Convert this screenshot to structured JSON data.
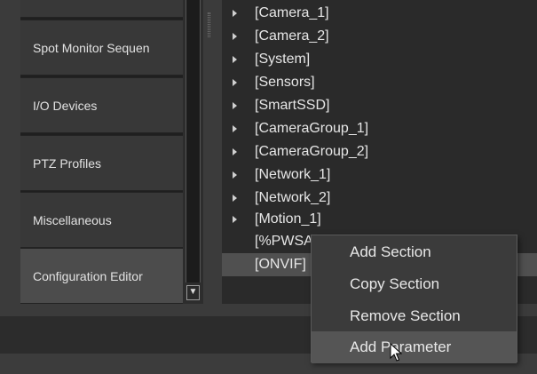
{
  "sidebar": {
    "items": [
      {
        "label": ""
      },
      {
        "label": "Spot Monitor Sequen"
      },
      {
        "label": "I/O Devices"
      },
      {
        "label": "PTZ Profiles"
      },
      {
        "label": "Miscellaneous"
      },
      {
        "label": "Configuration Editor",
        "active": true
      }
    ],
    "scroll_down_glyph": "▼"
  },
  "tree": {
    "sections": [
      {
        "label": "[Camera_1]",
        "expandable": true
      },
      {
        "label": "[Camera_2]",
        "expandable": true
      },
      {
        "label": "[System]",
        "expandable": true
      },
      {
        "label": "[Sensors]",
        "expandable": true
      },
      {
        "label": "[SmartSSD]",
        "expandable": true
      },
      {
        "label": "[CameraGroup_1]",
        "expandable": true
      },
      {
        "label": "[CameraGroup_2]",
        "expandable": true
      },
      {
        "label": "[Network_1]",
        "expandable": true
      },
      {
        "label": "[Network_2]",
        "expandable": true
      },
      {
        "label": "[Motion_1]",
        "expandable": true
      },
      {
        "label": "[%PWSA",
        "expandable": false
      },
      {
        "label": "[ONVIF]",
        "expandable": false,
        "selected": true
      }
    ]
  },
  "context_menu": {
    "items": [
      {
        "label": "Add Section"
      },
      {
        "label": "Copy Section"
      },
      {
        "label": "Remove Section"
      },
      {
        "label": "Add Parameter",
        "hover": true
      }
    ]
  },
  "icons": {
    "expand_arrow": "triangle-right-icon",
    "cursor": "mouse-pointer-icon"
  }
}
